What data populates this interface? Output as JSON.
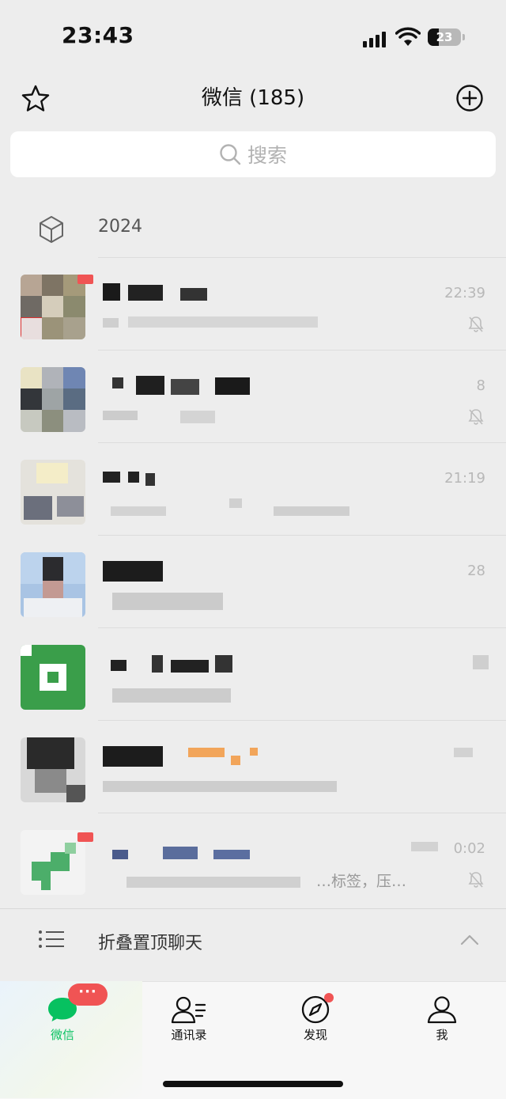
{
  "status_bar": {
    "time": "23:43",
    "battery": "23"
  },
  "header": {
    "title": "微信 (185)",
    "left_icon": "star-icon",
    "right_icon": "plus-circle-icon"
  },
  "search": {
    "placeholder": "搜索"
  },
  "folder": {
    "label": "2024",
    "icon": "cube-icon"
  },
  "chats": [
    {
      "time": "22:39",
      "muted": true,
      "has_unread_badge": true
    },
    {
      "time": "8",
      "muted": true,
      "has_unread_badge": false
    },
    {
      "time": "21:19",
      "muted": false,
      "has_unread_badge": false
    },
    {
      "time": "28",
      "muted": false,
      "has_unread_badge": false
    },
    {
      "time": "",
      "muted": false,
      "has_unread_badge": false
    },
    {
      "time": "",
      "muted": false,
      "has_unread_badge": false
    },
    {
      "time": "0:02",
      "preview": "…标签，压…",
      "muted": true,
      "has_unread_badge": true
    }
  ],
  "fold_bar": {
    "label": "折叠置顶聊天"
  },
  "tabs": [
    {
      "label": "微信",
      "icon": "chat-bubble-icon",
      "active": true,
      "badge": "···"
    },
    {
      "label": "通讯录",
      "icon": "contacts-icon",
      "active": false
    },
    {
      "label": "发现",
      "icon": "compass-icon",
      "active": false,
      "dot": true
    },
    {
      "label": "我",
      "icon": "person-icon",
      "active": false
    }
  ],
  "colors": {
    "accent": "#07c160",
    "badge": "#f05454",
    "background": "#ededed"
  }
}
